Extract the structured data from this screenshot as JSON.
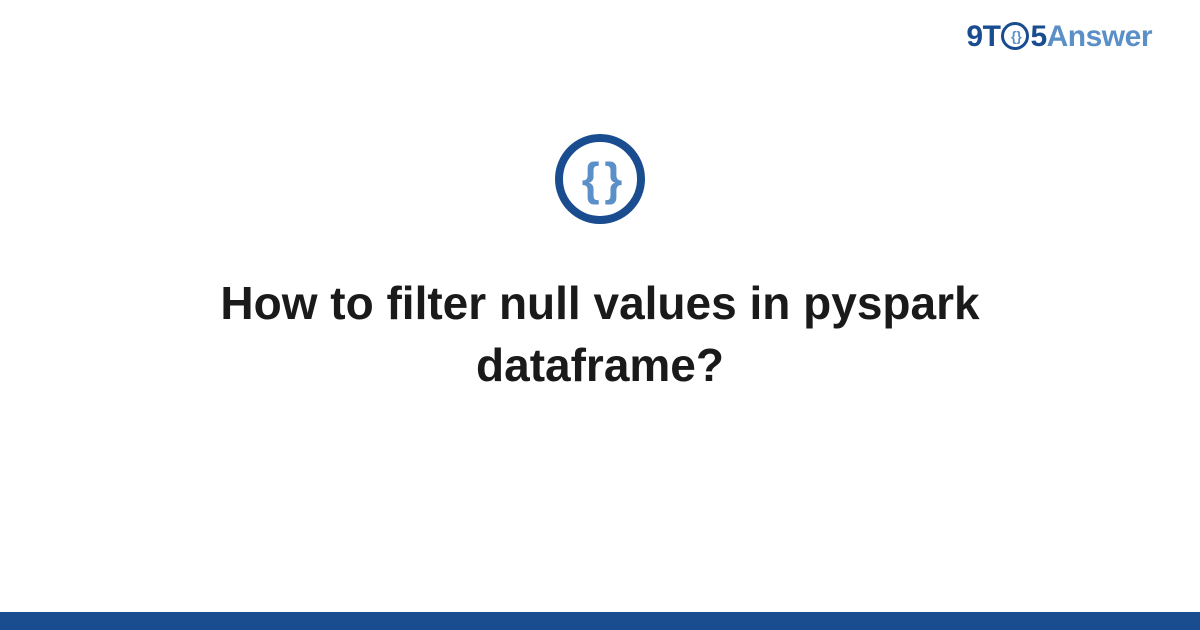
{
  "brand": {
    "part1": "9T",
    "circle_inner": "{ }",
    "part2": "5",
    "part3": "Answer"
  },
  "logo": {
    "braces": "{ }"
  },
  "title": "How to filter null values in pyspark dataframe?",
  "colors": {
    "dark_blue": "#1a4d8f",
    "light_blue": "#5b8fc7"
  }
}
